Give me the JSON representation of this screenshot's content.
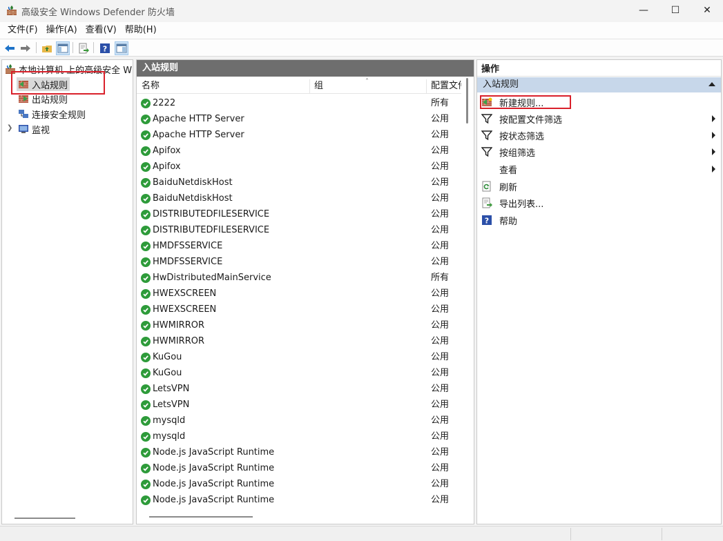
{
  "window": {
    "title": "高级安全 Windows Defender 防火墙",
    "title_icon": "firewall-icon",
    "controls": {
      "minimize": "—",
      "maximize": "☐",
      "close": "✕"
    }
  },
  "menu": [
    "文件(F)",
    "操作(A)",
    "查看(V)",
    "帮助(H)"
  ],
  "toolbar": {
    "icons": [
      "back-arrow-icon",
      "forward-arrow-icon",
      "up-folder-icon",
      "show-hide-tree-icon",
      "export-list-icon",
      "help-icon",
      "show-hide-action-pane-icon"
    ]
  },
  "tree": {
    "root": "本地计算机 上的高级安全 W",
    "items": [
      {
        "label": "入站规则",
        "icon": "inbound-rules-icon",
        "selected": true
      },
      {
        "label": "出站规则",
        "icon": "outbound-rules-icon",
        "selected": false
      },
      {
        "label": "连接安全规则",
        "icon": "connection-security-icon",
        "selected": false
      },
      {
        "label": "监视",
        "icon": "monitor-icon",
        "selected": false
      }
    ]
  },
  "list": {
    "title": "入站规则",
    "columns": {
      "name": "名称",
      "group": "组",
      "profile": "配置文件"
    },
    "rows": [
      {
        "name": "2222",
        "profile": "所有"
      },
      {
        "name": "Apache HTTP Server",
        "profile": "公用"
      },
      {
        "name": "Apache HTTP Server",
        "profile": "公用"
      },
      {
        "name": "Apifox",
        "profile": "公用"
      },
      {
        "name": "Apifox",
        "profile": "公用"
      },
      {
        "name": "BaiduNetdiskHost",
        "profile": "公用"
      },
      {
        "name": "BaiduNetdiskHost",
        "profile": "公用"
      },
      {
        "name": "DISTRIBUTEDFILESERVICE",
        "profile": "公用"
      },
      {
        "name": "DISTRIBUTEDFILESERVICE",
        "profile": "公用"
      },
      {
        "name": "HMDFSSERVICE",
        "profile": "公用"
      },
      {
        "name": "HMDFSSERVICE",
        "profile": "公用"
      },
      {
        "name": "HwDistributedMainService",
        "profile": "所有"
      },
      {
        "name": "HWEXSCREEN",
        "profile": "公用"
      },
      {
        "name": "HWEXSCREEN",
        "profile": "公用"
      },
      {
        "name": "HWMIRROR",
        "profile": "公用"
      },
      {
        "name": "HWMIRROR",
        "profile": "公用"
      },
      {
        "name": "KuGou",
        "profile": "公用"
      },
      {
        "name": "KuGou",
        "profile": "公用"
      },
      {
        "name": "LetsVPN",
        "profile": "公用"
      },
      {
        "name": "LetsVPN",
        "profile": "公用"
      },
      {
        "name": "mysqld",
        "profile": "公用"
      },
      {
        "name": "mysqld",
        "profile": "公用"
      },
      {
        "name": "Node.js JavaScript Runtime",
        "profile": "公用"
      },
      {
        "name": "Node.js JavaScript Runtime",
        "profile": "公用"
      },
      {
        "name": "Node.js JavaScript Runtime",
        "profile": "公用"
      },
      {
        "name": "Node.js JavaScript Runtime",
        "profile": "公用"
      }
    ]
  },
  "actions": {
    "title": "操作",
    "section": "入站规则",
    "items": [
      {
        "label": "新建规则...",
        "icon": "new-rule-icon",
        "submenu": false
      },
      {
        "label": "按配置文件筛选",
        "icon": "filter-icon",
        "submenu": true
      },
      {
        "label": "按状态筛选",
        "icon": "filter-icon",
        "submenu": true
      },
      {
        "label": "按组筛选",
        "icon": "filter-icon",
        "submenu": true
      },
      {
        "label": "查看",
        "icon": "",
        "submenu": true
      },
      {
        "label": "刷新",
        "icon": "refresh-icon",
        "submenu": false
      },
      {
        "label": "导出列表...",
        "icon": "export-list-icon",
        "submenu": false
      },
      {
        "label": "帮助",
        "icon": "help-icon",
        "submenu": false
      }
    ]
  },
  "colors": {
    "enabled_check": "#2e9b3a",
    "highlight_box": "#d9202a",
    "pane_title_bg": "#6e6e6e",
    "action_section_bg": "#c7d7ea"
  }
}
